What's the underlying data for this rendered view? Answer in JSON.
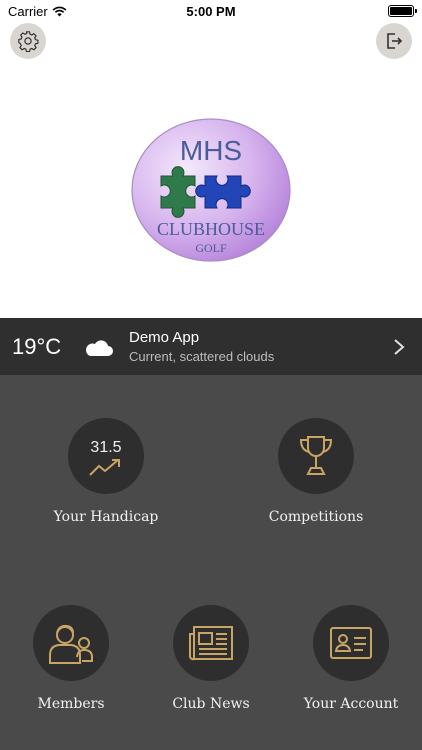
{
  "status_bar": {
    "carrier": "Carrier",
    "time": "5:00 PM",
    "battery_level": 1.0
  },
  "header": {
    "settings_icon": "gear-icon",
    "logout_icon": "logout-icon"
  },
  "logo": {
    "line1": "MHS",
    "line2": "CLUBHOUSE",
    "line3": "GOLF"
  },
  "weather": {
    "temperature": "19°C",
    "icon": "cloud-icon",
    "title": "Demo App",
    "description": "Current, scattered clouds"
  },
  "menu": {
    "handicap": {
      "value": "31.5",
      "label": "Your Handicap",
      "icon": "trend-icon"
    },
    "competitions": {
      "label": "Competitions",
      "icon": "trophy-icon"
    },
    "members": {
      "label": "Members",
      "icon": "members-icon"
    },
    "club_news": {
      "label": "Club News",
      "icon": "newspaper-icon"
    },
    "account": {
      "label": "Your Account",
      "icon": "id-card-icon"
    }
  },
  "colors": {
    "gold": "#c9a563",
    "dark_bg": "#4a4a4a",
    "weather_bg": "#2f2f2f"
  }
}
